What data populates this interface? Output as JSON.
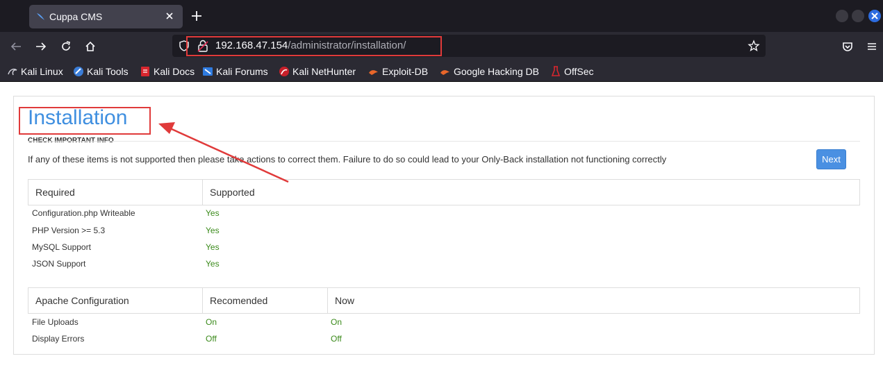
{
  "browser": {
    "tab_title": "Cuppa CMS",
    "url_host": "192.168.47.154",
    "url_path": "/administrator/installation/",
    "bookmarks": [
      {
        "label": "Kali Linux",
        "icon": "kali-dragon-icon"
      },
      {
        "label": "Kali Tools",
        "icon": "kali-tools-icon"
      },
      {
        "label": "Kali Docs",
        "icon": "kali-docs-icon"
      },
      {
        "label": "Kali Forums",
        "icon": "kali-forums-icon"
      },
      {
        "label": "Kali NetHunter",
        "icon": "kali-nethunter-icon"
      },
      {
        "label": "Exploit-DB",
        "icon": "exploit-db-icon"
      },
      {
        "label": "Google Hacking DB",
        "icon": "ghdb-icon"
      },
      {
        "label": "OffSec",
        "icon": "offsec-icon"
      }
    ]
  },
  "page": {
    "title": "Installation",
    "subhead": "CHECK IMPORTANT INFO",
    "info": "If any of these items is not supported then please take actions to correct them. Failure to do so could lead to your Only-Back installation not functioning correctly",
    "next_label": "Next",
    "requirements": {
      "headers": [
        "Required",
        "Supported"
      ],
      "rows": [
        {
          "name": "Configuration.php Writeable",
          "supported": "Yes"
        },
        {
          "name": "PHP Version >= 5.3",
          "supported": "Yes"
        },
        {
          "name": "MySQL Support",
          "supported": "Yes"
        },
        {
          "name": "JSON Support",
          "supported": "Yes"
        }
      ]
    },
    "apache": {
      "headers": [
        "Apache Configuration",
        "Recomended",
        "Now"
      ],
      "rows": [
        {
          "name": "File Uploads",
          "recommended": "On",
          "now": "On"
        },
        {
          "name": "Display Errors",
          "recommended": "Off",
          "now": "Off"
        }
      ]
    }
  },
  "colors": {
    "accent": "#3f8fe0",
    "ok": "#3a8a1a",
    "annotation": "#e03a3a"
  }
}
